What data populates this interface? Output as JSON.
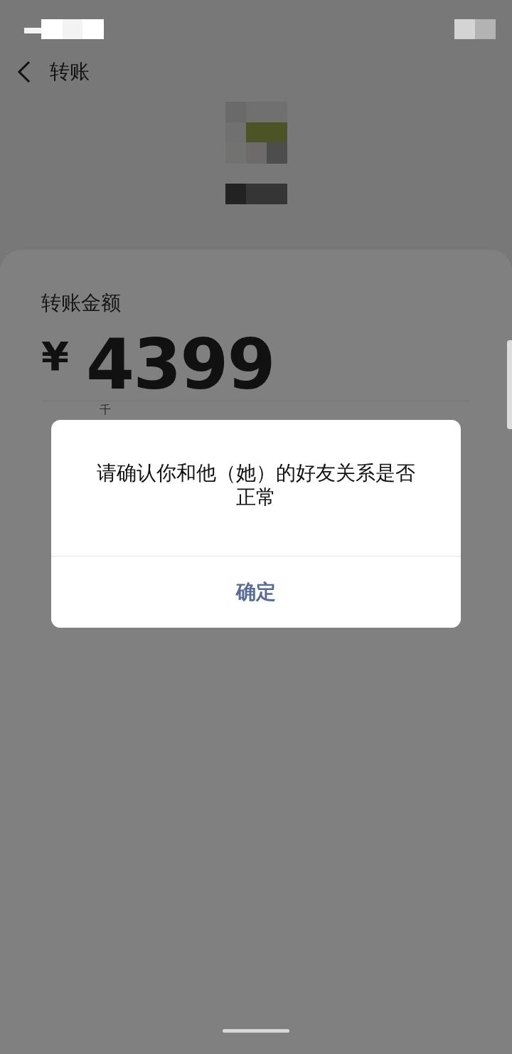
{
  "nav": {
    "title": "转账"
  },
  "amount_section": {
    "label": "转账金额",
    "currency": "¥",
    "amount": "4399",
    "unit_hint": "千"
  },
  "dialog": {
    "message": "请确认你和他（她）的好友关系是否正常",
    "button": "确定"
  }
}
